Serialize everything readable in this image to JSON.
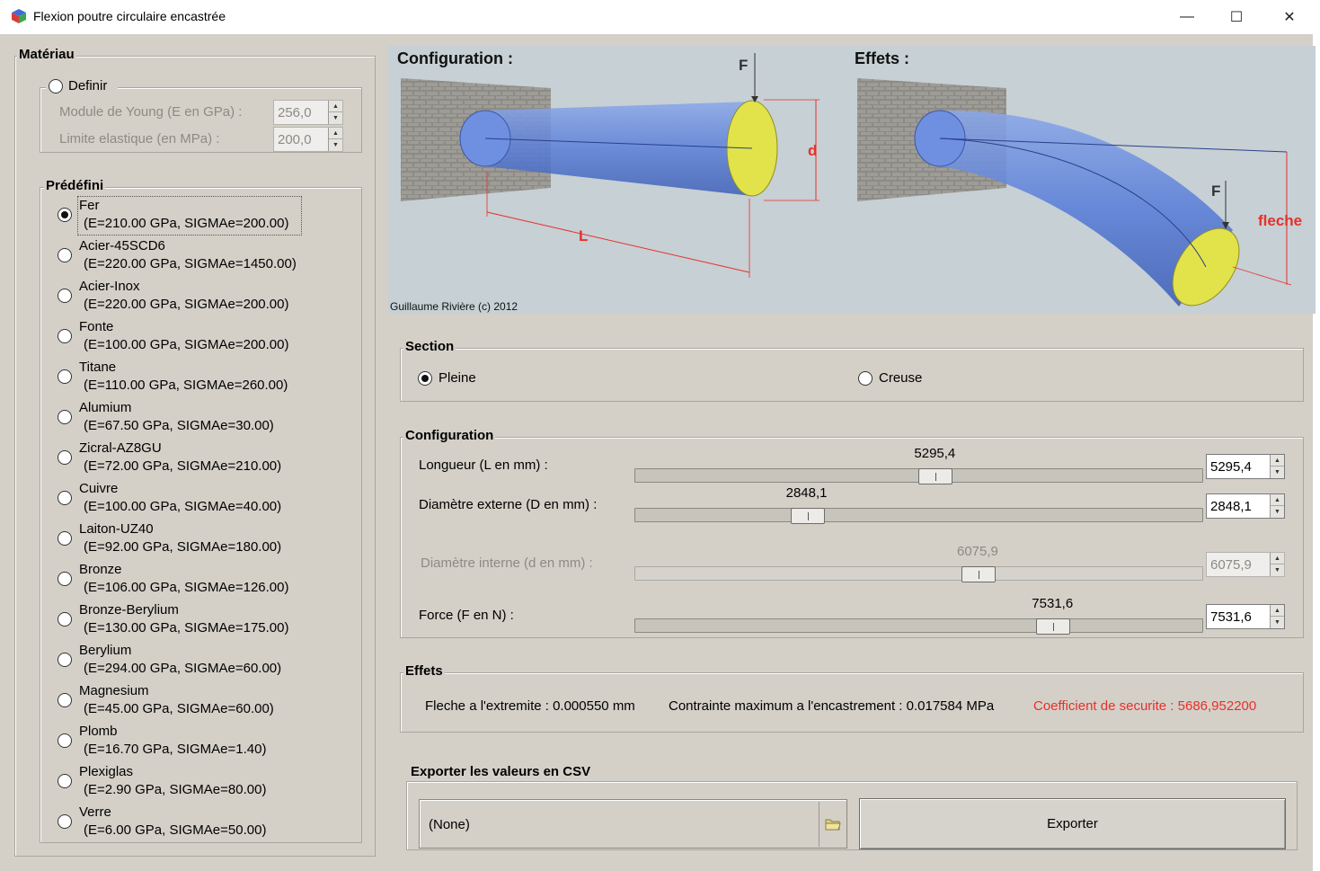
{
  "window": {
    "title": "Flexion poutre circulaire encastrée",
    "minimize": "—",
    "maximize": "☐",
    "close": "✕"
  },
  "materiau": {
    "legend": "Matériau",
    "definir": {
      "label": "Definir",
      "young_label": "Module de Young (E en GPa) :",
      "young_value": "256,0",
      "limite_label": "Limite elastique (en MPa) :",
      "limite_value": "200,0"
    },
    "predefini": {
      "legend": "Prédéfini",
      "items": [
        {
          "name": "Fer",
          "props": "(E=210.00 GPa, SIGMAe=200.00)",
          "checked": true
        },
        {
          "name": "Acier-45SCD6",
          "props": "(E=220.00 GPa, SIGMAe=1450.00)"
        },
        {
          "name": "Acier-Inox",
          "props": "(E=220.00 GPa, SIGMAe=200.00)"
        },
        {
          "name": "Fonte",
          "props": "(E=100.00 GPa, SIGMAe=200.00)"
        },
        {
          "name": "Titane",
          "props": "(E=110.00 GPa, SIGMAe=260.00)"
        },
        {
          "name": "Alumium",
          "props": "(E=67.50 GPa, SIGMAe=30.00)"
        },
        {
          "name": "Zicral-AZ8GU",
          "props": "(E=72.00 GPa, SIGMAe=210.00)"
        },
        {
          "name": "Cuivre",
          "props": "(E=100.00 GPa, SIGMAe=40.00)"
        },
        {
          "name": "Laiton-UZ40",
          "props": "(E=92.00 GPa, SIGMAe=180.00)"
        },
        {
          "name": "Bronze",
          "props": "(E=106.00 GPa, SIGMAe=126.00)"
        },
        {
          "name": "Bronze-Berylium",
          "props": "(E=130.00 GPa, SIGMAe=175.00)"
        },
        {
          "name": "Berylium",
          "props": "(E=294.00 GPa, SIGMAe=60.00)"
        },
        {
          "name": "Magnesium",
          "props": "(E=45.00 GPa, SIGMAe=60.00)"
        },
        {
          "name": "Plomb",
          "props": "(E=16.70 GPa, SIGMAe=1.40)"
        },
        {
          "name": "Plexiglas",
          "props": "(E=2.90 GPa, SIGMAe=80.00)"
        },
        {
          "name": "Verre",
          "props": "(E=6.00 GPa, SIGMAe=50.00)"
        }
      ]
    }
  },
  "preview": {
    "config_title": "Configuration :",
    "effets_title": "Effets :",
    "label_F": "F",
    "label_d": "d",
    "label_L": "L",
    "label_fleche": "fleche",
    "credit": "Guillaume Rivière (c) 2012",
    "accent_red": "#e8302a"
  },
  "section": {
    "legend": "Section",
    "pleine": "Pleine",
    "creuse": "Creuse",
    "selected": "Pleine"
  },
  "configuration": {
    "legend": "Configuration",
    "sliders": [
      {
        "label": "Longueur (L en mm) :",
        "value": "5295,4",
        "fraction": 0.53,
        "enabled": true
      },
      {
        "label": "Diamètre externe (D en mm) :",
        "value": "2848,1",
        "fraction": 0.29,
        "enabled": true
      },
      {
        "label": "Diamètre interne (d en mm) :",
        "value": "6075,9",
        "fraction": 0.61,
        "enabled": false
      },
      {
        "label": "Force (F en N) :",
        "value": "7531,6",
        "fraction": 0.75,
        "enabled": true
      }
    ]
  },
  "effets": {
    "legend": "Effets",
    "fleche": "Fleche a l'extremite : 0.000550 mm",
    "contrainte": "Contrainte maximum a l'encastrement : 0.017584 MPa",
    "securite": "Coefficient de securite : 5686,952200",
    "securite_color": "#e8302a"
  },
  "export": {
    "legend": "Exporter les valeurs en CSV",
    "path": "(None)",
    "browse_icon": "folder-icon",
    "button": "Exporter"
  }
}
